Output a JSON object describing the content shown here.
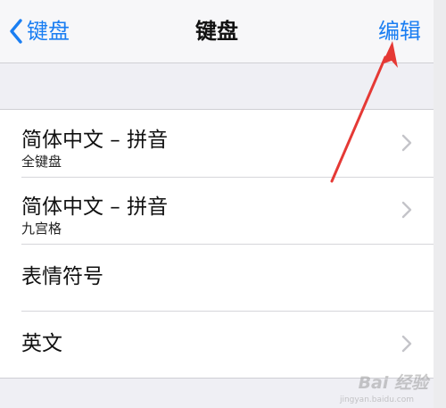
{
  "nav": {
    "back_label": "键盘",
    "title": "键盘",
    "edit_label": "编辑"
  },
  "keyboards": [
    {
      "title": "简体中文 – 拼音",
      "subtitle": "全键盘",
      "chevron": true
    },
    {
      "title": "简体中文 – 拼音",
      "subtitle": "九宫格",
      "chevron": true
    },
    {
      "title": "表情符号",
      "subtitle": "",
      "chevron": false
    },
    {
      "title": "英文",
      "subtitle": "",
      "chevron": true
    }
  ],
  "watermark": {
    "text": "Bai 经验",
    "sub": "jingyan.baidu.com"
  },
  "colors": {
    "accent": "#1a7ef2",
    "annotation_arrow": "#e53935",
    "background": "#efeff4"
  },
  "icons": {
    "back": "chevron-left-icon",
    "disclosure": "chevron-right-icon"
  }
}
